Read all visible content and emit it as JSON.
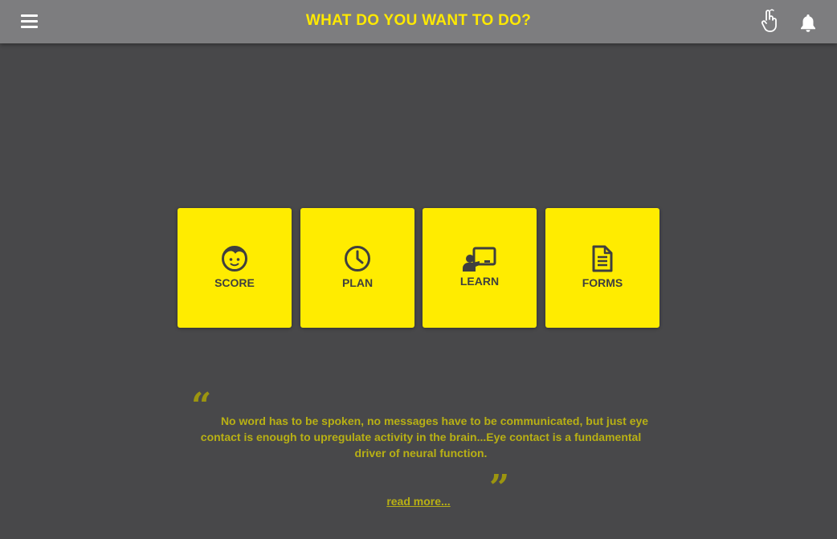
{
  "header": {
    "title": "WHAT DO YOU WANT TO DO?",
    "menu_icon": "hamburger-menu-icon",
    "hand_icon": "hand-pointer-icon",
    "bell_icon": "bell-icon"
  },
  "tiles": [
    {
      "label": "SCORE",
      "icon": "child-face-icon"
    },
    {
      "label": "PLAN",
      "icon": "clock-icon"
    },
    {
      "label": "LEARN",
      "icon": "teacher-board-icon"
    },
    {
      "label": "FORMS",
      "icon": "document-icon"
    }
  ],
  "quote": {
    "open_mark": "“",
    "text": "No word has to be spoken, no messages have to be communicated, but just eye contact is enough to upregulate activity in the brain...Eye contact is a fundamental driver of neural function.",
    "close_mark": "”",
    "read_more": "read more..."
  },
  "colors": {
    "background": "#48484a",
    "header": "#7d7d7f",
    "accent": "#ffec00",
    "quote_text": "#b8b014"
  }
}
